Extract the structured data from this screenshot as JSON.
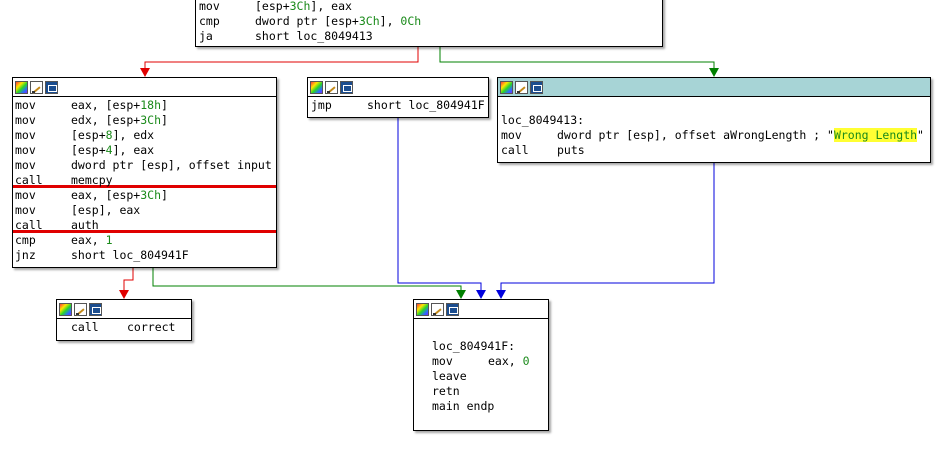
{
  "colors": {
    "edge_false": "#e00000",
    "edge_true": "#008000",
    "edge_uncond": "#0000dd",
    "header_selected": "#a7d4d6",
    "number": "#1a8a1a",
    "highlight": "#ffff33"
  },
  "toolbar_icons": [
    "color-palette-icon",
    "rename-pencil-icon",
    "graph-view-icon"
  ],
  "blocks": {
    "top": {
      "lines": [
        {
          "mnem": "mov",
          "ops": "[esp+",
          "num": "3Ch",
          "rest": "], eax"
        },
        {
          "mnem": "cmp",
          "ops": "dword ptr [esp+",
          "num": "3Ch",
          "rest": "], ",
          "num2": "0Ch"
        },
        {
          "mnem": "ja",
          "ops": "short loc_8049413"
        }
      ]
    },
    "left": {
      "lines": [
        {
          "mnem": "mov",
          "a": "eax, [esp+",
          "n": "18h",
          "b": "]"
        },
        {
          "mnem": "mov",
          "a": "edx, [esp+",
          "n": "3Ch",
          "b": "]"
        },
        {
          "mnem": "mov",
          "a": "[esp+",
          "n": "8",
          "b": "], edx"
        },
        {
          "mnem": "mov",
          "a": "[esp+",
          "n": "4",
          "b": "], eax"
        },
        {
          "mnem": "mov",
          "a": "dword ptr [esp], offset input",
          "n": "",
          "b": ""
        },
        {
          "mnem": "call",
          "a": "memcpy",
          "n": "",
          "b": ""
        },
        {
          "mnem": "mov",
          "a": "eax, [esp+",
          "n": "3Ch",
          "b": "]"
        },
        {
          "mnem": "mov",
          "a": "[esp], eax",
          "n": "",
          "b": ""
        },
        {
          "mnem": "call",
          "a": "auth",
          "n": "",
          "b": ""
        },
        {
          "mnem": "cmp",
          "a": "eax, ",
          "n": "1",
          "b": ""
        },
        {
          "mnem": "jnz",
          "a": "short loc_804941F",
          "n": "",
          "b": ""
        }
      ]
    },
    "jmp": {
      "mnem": "jmp",
      "ops": "short loc_804941F"
    },
    "wrong": {
      "label": "loc_8049413:",
      "mov_mnem": "mov",
      "mov_ops": "dword ptr [esp], offset aWrongLength ; \"",
      "string": "Wrong Length",
      "quote_close": "\"",
      "call_mnem": "call",
      "call_ops": "puts"
    },
    "correct": {
      "mnem": "call",
      "ops": "correct"
    },
    "end": {
      "label": "loc_804941F:",
      "mov_mnem": "mov",
      "mov_ops": "eax, ",
      "mov_num": "0",
      "l2": "leave",
      "l3": "retn",
      "l4": "main endp"
    }
  }
}
